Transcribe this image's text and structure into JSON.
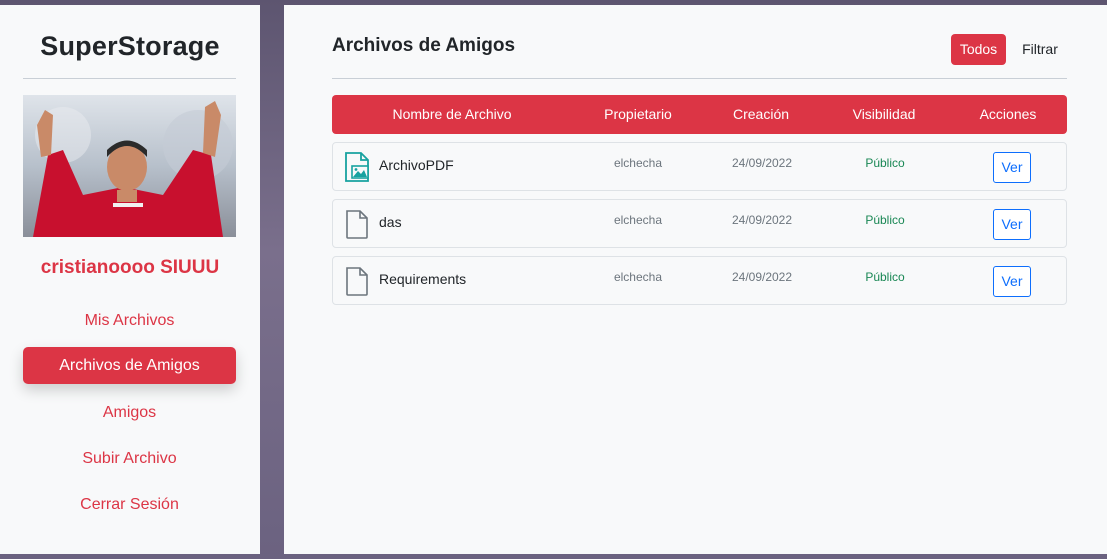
{
  "sidebar": {
    "brand": "SuperStorage",
    "username": "cristianoooo SIUUU",
    "nav": [
      {
        "label": "Mis Archivos"
      },
      {
        "label": "Archivos de Amigos"
      },
      {
        "label": "Amigos"
      },
      {
        "label": "Subir Archivo"
      },
      {
        "label": "Cerrar Sesión"
      }
    ],
    "active_index": 1
  },
  "main": {
    "title": "Archivos de Amigos",
    "filter_all_label": "Todos",
    "filter_label": "Filtrar",
    "table": {
      "headers": [
        "Nombre de Archivo",
        "Propietario",
        "Creación",
        "Visibilidad",
        "Acciones"
      ],
      "rows": [
        {
          "name": "ArchivoPDF",
          "owner": "elchecha",
          "created": "24/09/2022",
          "visibility": "Público",
          "action": "Ver",
          "icon": "file-image-icon"
        },
        {
          "name": "das",
          "owner": "elchecha",
          "created": "24/09/2022",
          "visibility": "Público",
          "action": "Ver",
          "icon": "file-icon"
        },
        {
          "name": "Requirements",
          "owner": "elchecha",
          "created": "24/09/2022",
          "visibility": "Público",
          "action": "Ver",
          "icon": "file-icon"
        }
      ]
    }
  },
  "colors": {
    "accent": "#dc3545",
    "link": "#0d6efd",
    "success": "#198754",
    "image_icon": "#17a2a0"
  }
}
